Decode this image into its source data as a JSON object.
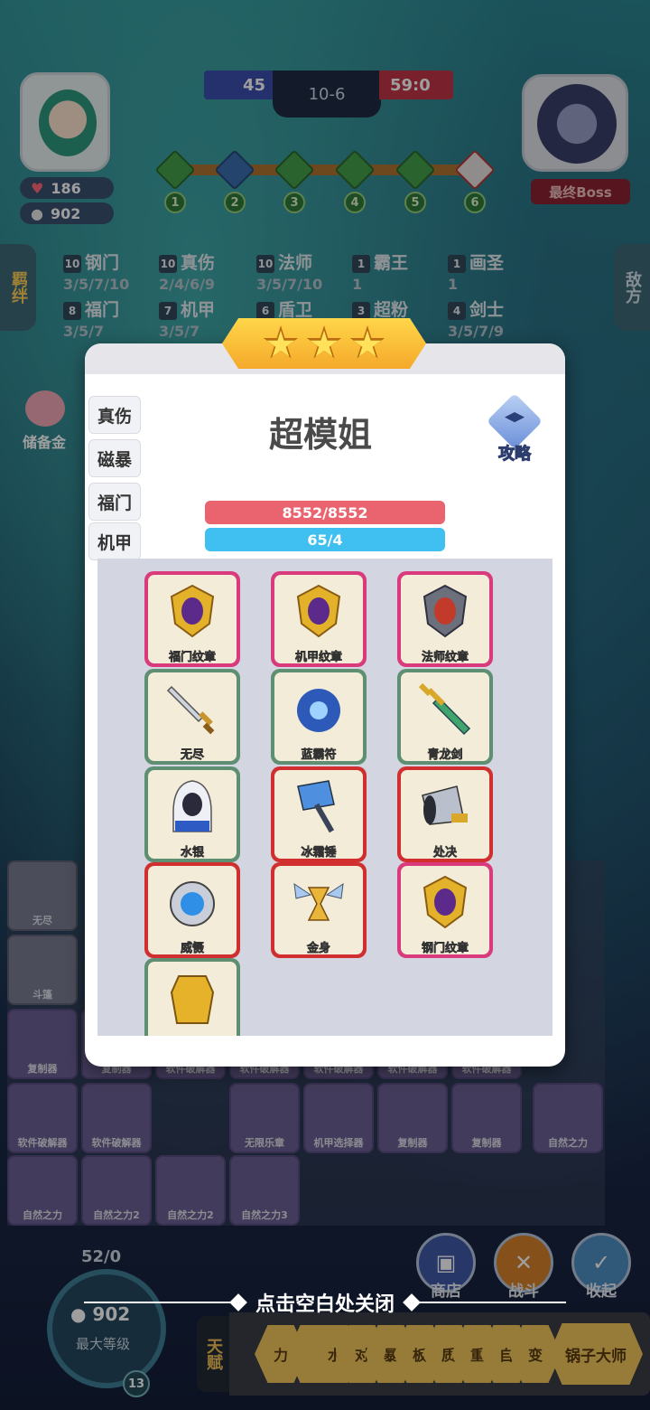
{
  "hud": {
    "score_blue": "45",
    "round": "10-6",
    "score_red": "59:0",
    "player_hp": "186",
    "player_gold": "902",
    "boss_label": "最终Boss",
    "stages": [
      "1",
      "2",
      "3",
      "4",
      "5",
      "6"
    ]
  },
  "side_tabs": {
    "left": "羁绊",
    "right": "敌方"
  },
  "traits": [
    {
      "count": "10",
      "name": "钢门",
      "levels": "3/5/7/10"
    },
    {
      "count": "10",
      "name": "真伤",
      "levels": "2/4/6/9"
    },
    {
      "count": "10",
      "name": "法师",
      "levels": "3/5/7/10"
    },
    {
      "count": "1",
      "name": "霸王",
      "levels": "1"
    },
    {
      "count": "1",
      "name": "画圣",
      "levels": "1"
    },
    {
      "count": "8",
      "name": "福门",
      "levels": "3/5/7"
    },
    {
      "count": "7",
      "name": "机甲",
      "levels": "3/5/7"
    },
    {
      "count": "6",
      "name": "盾卫",
      "levels": ""
    },
    {
      "count": "3",
      "name": "超粉",
      "levels": ""
    },
    {
      "count": "4",
      "name": "剑士",
      "levels": "3/5/7/9"
    }
  ],
  "piggy_label": "储备金",
  "modal": {
    "hero_name": "超模姐",
    "guide_label": "攻略",
    "hp": "8552/8552",
    "mana": "65/4",
    "trait_tabs": [
      "真伤",
      "磁暴",
      "福门",
      "机甲"
    ],
    "items": [
      {
        "name": "福门纹章",
        "rarity": "pink",
        "icon": "emblem-purple-gem"
      },
      {
        "name": "机甲纹章",
        "rarity": "pink",
        "icon": "emblem-purple-gem"
      },
      {
        "name": "法师纹章",
        "rarity": "pink",
        "icon": "emblem-red-gem"
      },
      {
        "name": "无尽",
        "rarity": "green",
        "icon": "sword-icon"
      },
      {
        "name": "蓝霸符",
        "rarity": "green",
        "icon": "blue-orb-icon"
      },
      {
        "name": "青龙剑",
        "rarity": "green",
        "icon": "green-sword-icon"
      },
      {
        "name": "水银",
        "rarity": "green",
        "icon": "hooded-cloak-icon"
      },
      {
        "name": "冰霜锤",
        "rarity": "red",
        "icon": "ice-hammer-icon"
      },
      {
        "name": "处决",
        "rarity": "red",
        "icon": "cannon-icon"
      },
      {
        "name": "威慑",
        "rarity": "red",
        "icon": "shield-ring-icon"
      },
      {
        "name": "金身",
        "rarity": "red",
        "icon": "hourglass-icon"
      },
      {
        "name": "钢门纹章",
        "rarity": "pink",
        "icon": "emblem-purple-gem"
      },
      {
        "name": "",
        "rarity": "green",
        "icon": "golden-armor-icon"
      }
    ]
  },
  "bench": [
    {
      "label": "无尽"
    },
    {
      "label": "斗篷"
    },
    {
      "label": "复制器"
    },
    {
      "label": "复制器"
    },
    {
      "label": "软件破解器"
    },
    {
      "label": "软件破解器"
    },
    {
      "label": "软件破解器"
    },
    {
      "label": "软件破解器"
    },
    {
      "label": "软件破解器"
    },
    {
      "label": "软件破解器"
    },
    {
      "label": "软件破解器"
    },
    {
      "label": "无限乐章"
    },
    {
      "label": "机甲选择器"
    },
    {
      "label": "复制器"
    },
    {
      "label": "复制器"
    },
    {
      "label": "自然之力"
    },
    {
      "label": "自然之力"
    },
    {
      "label": "自然之力2"
    },
    {
      "label": "自然之力2"
    },
    {
      "label": "自然之力3"
    }
  ],
  "bottom": {
    "exp": "52/0",
    "level_gold": "902",
    "level_text": "最大等级",
    "level_badge": "13",
    "shop_label": "商店",
    "battle_label": "战斗",
    "collapse_label": "收起",
    "talent_tab": "天赋",
    "talents": [
      "力",
      "水",
      "对",
      "暴",
      "板",
      "质",
      "重",
      "自",
      "变",
      "锅子大师"
    ],
    "close_hint": "点击空白处关闭"
  },
  "colors": {
    "hp": "#e9646f",
    "mana": "#3fc0f0",
    "gold_banner": "#ffd64a"
  }
}
